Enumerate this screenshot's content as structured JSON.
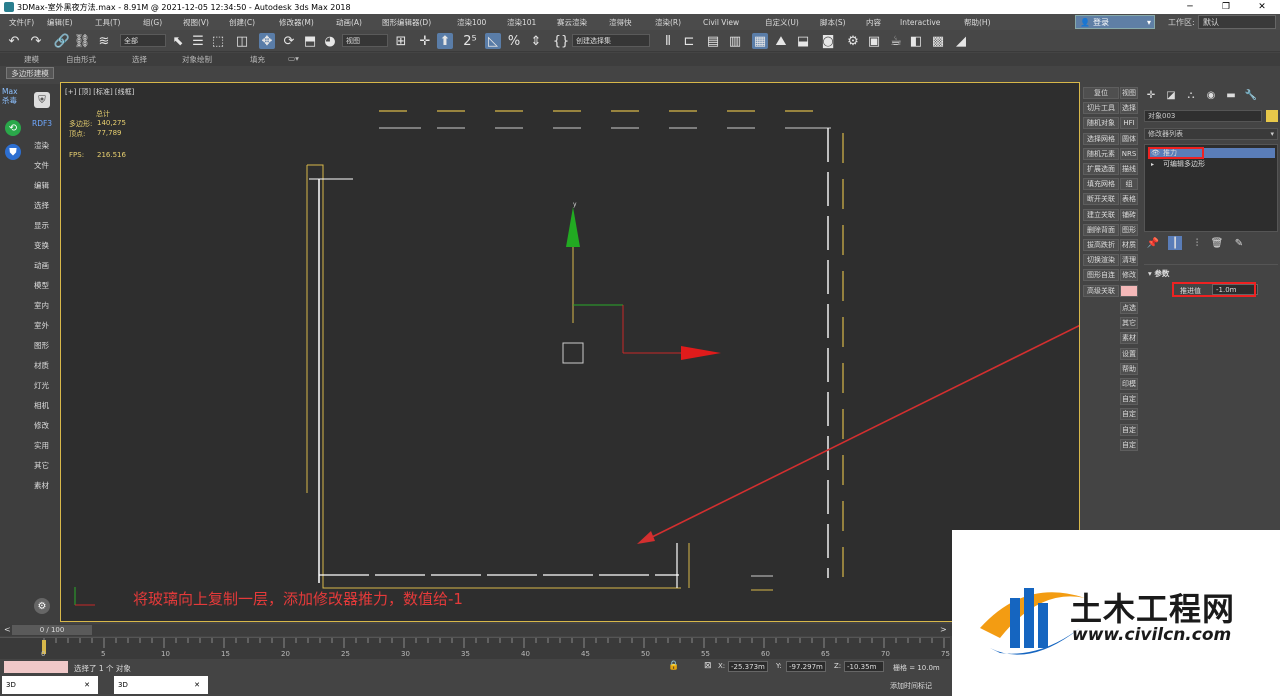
{
  "window": {
    "title": "3DMax-室外黑夜方法.max - 8.91M @ 2021-12-05 12:34:50 - Autodesk 3ds Max 2018",
    "controls": [
      "─",
      "❐",
      "✕"
    ]
  },
  "menu": {
    "items": [
      "文件(F)",
      "编辑(E)",
      "工具(T)",
      "组(G)",
      "视图(V)",
      "创建(C)",
      "修改器(M)",
      "动画(A)",
      "图形编辑器(D)",
      "渲染100",
      "渲染101",
      "赛云渲染",
      "渲得快",
      "渲染(R)",
      "Civil View",
      "自定义(U)",
      "脚本(S)",
      "内容",
      "Interactive",
      "帮助(H)"
    ],
    "login": "登录",
    "workspace_label": "工作区:",
    "workspace_value": "默认"
  },
  "toolbar": {
    "selection_filter": "全部",
    "view_dropdown": "视图",
    "selection_set": "创建选择集"
  },
  "ribbon": {
    "tabs": [
      "建模",
      "自由形式",
      "选择",
      "对象绘制",
      "填充"
    ],
    "active_subtab": "多边形建模"
  },
  "left_sidebar": {
    "logo_top": "Max",
    "logo_bottom": "杀毒",
    "rdf_label": "RDF3",
    "items": [
      "渲染",
      "文件",
      "编辑",
      "选择",
      "显示",
      "变换",
      "动画",
      "模型",
      "室内",
      "室外",
      "图形",
      "材质",
      "灯光",
      "相机",
      "修改",
      "实用",
      "其它",
      "素材"
    ]
  },
  "viewport": {
    "label": "[+] [顶] [标准] [线框]",
    "stats_title": "总计",
    "poly_label": "多边形:",
    "poly_value": "140,275",
    "vert_label": "顶点:",
    "vert_value": "77,789",
    "fps_label": "FPS:",
    "fps_value": "216.516",
    "axis_y": "y",
    "annotation": "将玻璃向上复制一层，添加修改器推力，数值给-1"
  },
  "right_buttons": {
    "rows": [
      [
        "复位",
        "视图"
      ],
      [
        "切片工具",
        "选择"
      ],
      [
        "随机对象",
        "HFI"
      ],
      [
        "选择网格",
        "圆体"
      ],
      [
        "随机元素",
        "NRS"
      ],
      [
        "扩展选面",
        "描线"
      ],
      [
        "填充网格",
        "组"
      ],
      [
        "断开关联",
        "表格"
      ],
      [
        "建立关联",
        "铺砖"
      ],
      [
        "删除背面",
        "图形"
      ],
      [
        "拔高跌折",
        "材质"
      ],
      [
        "切换渲染",
        "清理"
      ],
      [
        "图形自连",
        "修改"
      ],
      [
        "高级关联",
        ""
      ]
    ],
    "tail": [
      "点选",
      "其它",
      "素材",
      "设置",
      "帮助",
      "印模",
      "自定",
      "自定",
      "自定",
      "自定"
    ]
  },
  "command_panel": {
    "object_name": "对象003",
    "modifier_list": "修改器列表",
    "stack": [
      "推力",
      "可编辑多边形"
    ],
    "params_title": "参数",
    "push_label": "推进值",
    "push_value": "-1.0m"
  },
  "timeline": {
    "frame": "0 / 100",
    "ticks": [
      "0",
      "5",
      "10",
      "15",
      "20",
      "25",
      "30",
      "35",
      "40",
      "45",
      "50",
      "55",
      "60",
      "65",
      "70",
      "75"
    ]
  },
  "status": {
    "selected_text": "选择了 1 个 对象",
    "x_label": "X:",
    "x_value": "-25.373m",
    "y_label": "Y:",
    "y_value": "-97.297m",
    "z_label": "Z:",
    "z_value": "-10.35m",
    "grid_label": "栅格 = 10.0m",
    "add_time_tag": "添加时间标记",
    "task_thumbs": [
      "3D",
      "3D"
    ]
  },
  "watermark": {
    "title": "土木工程网",
    "url": "www.civilcn.com"
  },
  "colors": {
    "accent_blue": "#5a7db8",
    "annotation_red": "#e53a3a",
    "viewport_border": "#d8b84a",
    "stats_yellow": "#e8d070"
  }
}
